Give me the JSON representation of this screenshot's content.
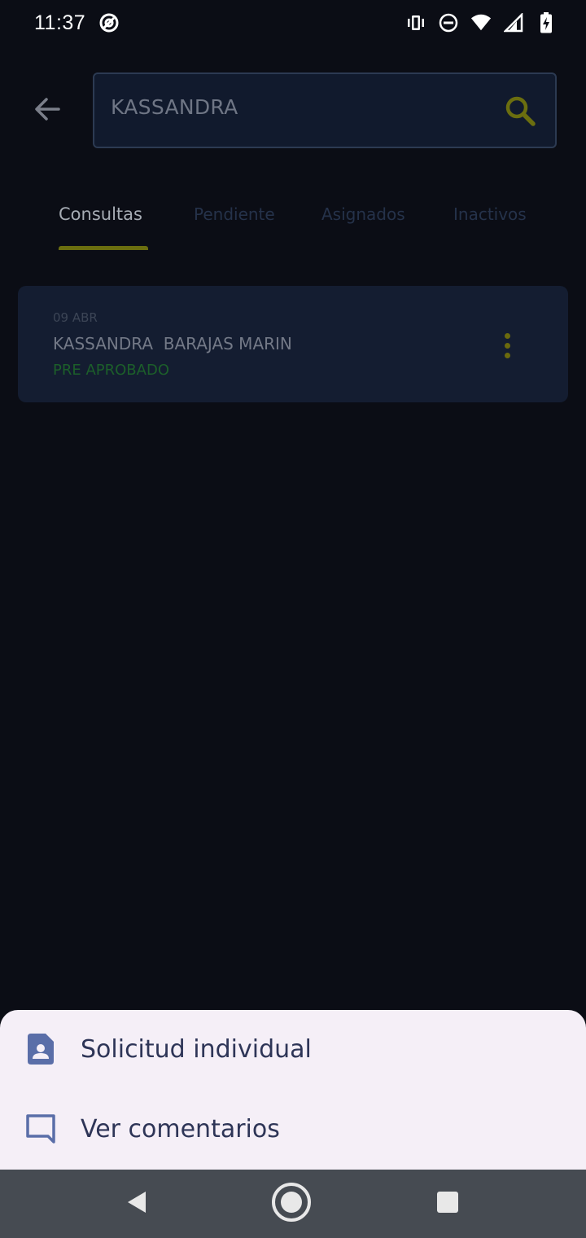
{
  "status_bar": {
    "time": "11:37",
    "icons": [
      "at-sign-icon",
      "vibrate-icon",
      "do-not-disturb-icon",
      "wifi-icon",
      "cell-signal-icon",
      "battery-charging-icon"
    ]
  },
  "header": {
    "back_icon": "arrow-left-icon",
    "search_value": "KASSANDRA",
    "search_icon": "search-icon"
  },
  "tabs": [
    {
      "label": "Consultas",
      "active": true
    },
    {
      "label": "Pendiente",
      "active": false
    },
    {
      "label": "Asignados",
      "active": false
    },
    {
      "label": "Inactivos",
      "active": false
    }
  ],
  "results": [
    {
      "date": "09 ABR",
      "name": "KASSANDRA  BARAJAS MARIN",
      "status": "PRE APROBADO",
      "menu_icon": "more-vertical-icon"
    }
  ],
  "bottom_sheet": {
    "items": [
      {
        "label": "Solicitud individual",
        "icon": "contact-file-icon"
      },
      {
        "label": "Ver comentarios",
        "icon": "comment-icon"
      }
    ]
  },
  "nav_bar": {
    "icons": [
      "nav-back-icon",
      "nav-home-icon",
      "nav-recents-icon"
    ]
  },
  "colors": {
    "background": "#0b0d15",
    "accent": "#6b6e0f",
    "status_approved": "#1c5f2a",
    "sheet_background": "#f5eff7",
    "sheet_text": "#2e3557",
    "sheet_icon": "#5a6ea8"
  }
}
